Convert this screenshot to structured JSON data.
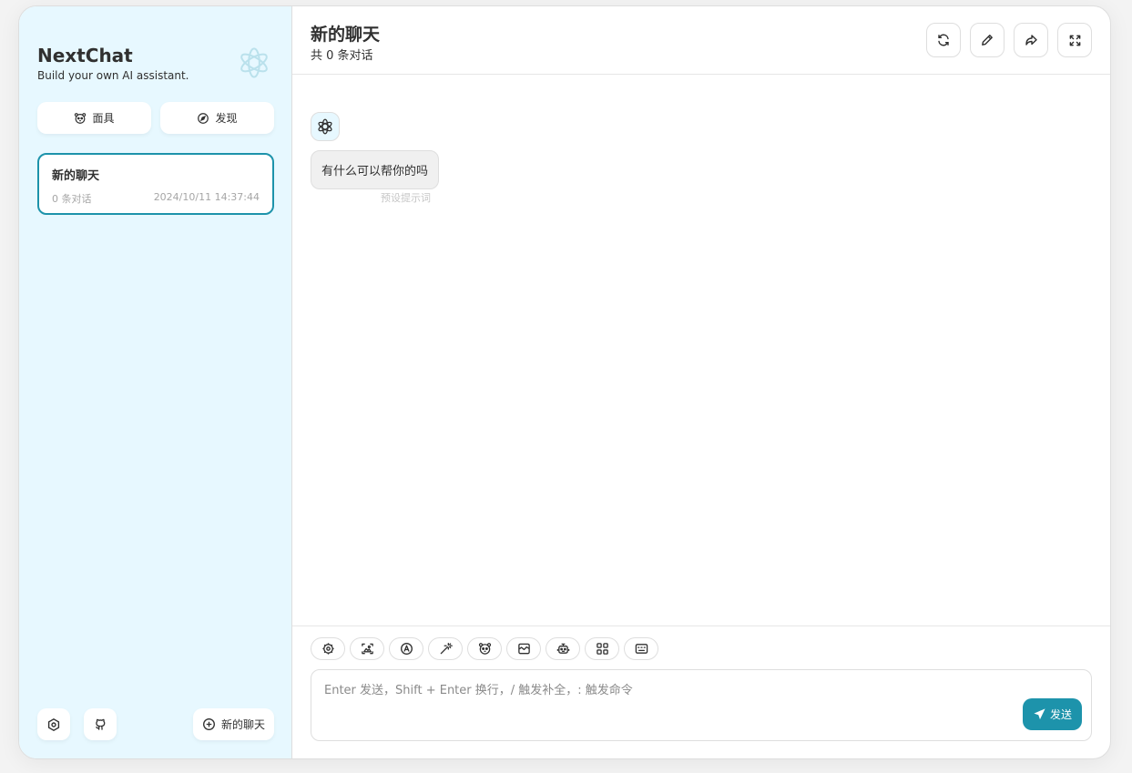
{
  "sidebar": {
    "brand_title": "NextChat",
    "brand_subtitle": "Build your own AI assistant.",
    "mask_button": "面具",
    "discover_button": "发现",
    "chats": [
      {
        "title": "新的聊天",
        "count": "0 条对话",
        "time": "2024/10/11 14:37:44"
      }
    ],
    "new_chat_button": "新的聊天"
  },
  "header": {
    "title": "新的聊天",
    "subtitle": "共 0 条对话"
  },
  "messages": [
    {
      "role": "assistant",
      "text": "有什么可以帮你的吗",
      "date": "预设提示词"
    }
  ],
  "composer": {
    "placeholder": "Enter 发送，Shift + Enter 换行，/ 触发补全，: 触发命令",
    "value": "",
    "send_label": "发送"
  },
  "colors": {
    "accent": "#1d93ab",
    "sidebar_bg": "#e7f8ff",
    "border": "#dedede"
  }
}
